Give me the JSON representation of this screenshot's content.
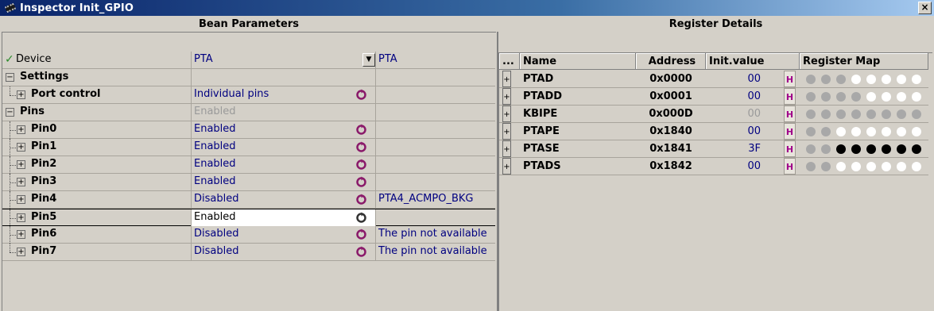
{
  "window": {
    "title": "Inspector Init_GPIO",
    "close_label": "×"
  },
  "left": {
    "caption": "Bean Parameters",
    "rows": [
      {
        "name": "Device",
        "value": "PTA",
        "info": "PTA"
      },
      {
        "name": "Settings",
        "value": "",
        "info": ""
      },
      {
        "name": "Port control",
        "value": "Individual pins",
        "info": ""
      },
      {
        "name": "Pins",
        "value": "Enabled",
        "info": ""
      },
      {
        "name": "Pin0",
        "value": "Enabled",
        "info": ""
      },
      {
        "name": "Pin1",
        "value": "Enabled",
        "info": ""
      },
      {
        "name": "Pin2",
        "value": "Enabled",
        "info": ""
      },
      {
        "name": "Pin3",
        "value": "Enabled",
        "info": ""
      },
      {
        "name": "Pin4",
        "value": "Disabled",
        "info": "PTA4_ACMPO_BKG"
      },
      {
        "name": "Pin5",
        "value": "Enabled",
        "info": ""
      },
      {
        "name": "Pin6",
        "value": "Disabled",
        "info": "The pin not available"
      },
      {
        "name": "Pin7",
        "value": "Disabled",
        "info": "The pin not available"
      }
    ]
  },
  "right": {
    "caption": "Register Details",
    "headers": {
      "dots": "...",
      "name": "Name",
      "address": "Address",
      "init": "Init.value",
      "map": "Register Map"
    },
    "rows": [
      {
        "name": "PTAD",
        "address": "0x0000",
        "init": "00",
        "badge": "H",
        "bits": [
          0,
          0,
          0,
          0,
          0,
          0,
          0,
          0
        ],
        "disabled_bits": [
          1,
          1,
          1,
          0,
          0,
          0,
          0,
          0
        ]
      },
      {
        "name": "PTADD",
        "address": "0x0001",
        "init": "00",
        "badge": "H",
        "bits": [
          0,
          0,
          0,
          0,
          0,
          0,
          0,
          0
        ],
        "disabled_bits": [
          1,
          1,
          1,
          1,
          0,
          0,
          0,
          0
        ]
      },
      {
        "name": "KBIPE",
        "address": "0x000D",
        "init": "00",
        "badge": "H",
        "bits": [
          0,
          0,
          0,
          0,
          0,
          0,
          0,
          0
        ],
        "disabled_bits": [
          1,
          1,
          1,
          1,
          1,
          1,
          1,
          1
        ]
      },
      {
        "name": "PTAPE",
        "address": "0x1840",
        "init": "00",
        "badge": "H",
        "bits": [
          0,
          0,
          0,
          0,
          0,
          0,
          0,
          0
        ],
        "disabled_bits": [
          1,
          1,
          0,
          0,
          0,
          0,
          0,
          0
        ]
      },
      {
        "name": "PTASE",
        "address": "0x1841",
        "init": "3F",
        "badge": "H",
        "bits": [
          0,
          0,
          1,
          1,
          1,
          1,
          1,
          1
        ],
        "disabled_bits": [
          1,
          1,
          0,
          0,
          0,
          0,
          0,
          0
        ]
      },
      {
        "name": "PTADS",
        "address": "0x1842",
        "init": "00",
        "badge": "H",
        "bits": [
          0,
          0,
          0,
          0,
          0,
          0,
          0,
          0
        ],
        "disabled_bits": [
          1,
          1,
          0,
          0,
          0,
          0,
          0,
          0
        ]
      }
    ]
  },
  "colors": {
    "title_start": "#0a246a",
    "value_blue": "#000080",
    "disabled_gray": "#9a9a9a",
    "accent_magenta": "#a0008a"
  },
  "icons": {
    "app": "chip-icon",
    "reset": "reset-icon",
    "expand": "plus-box-icon",
    "collapse": "minus-box-icon"
  }
}
